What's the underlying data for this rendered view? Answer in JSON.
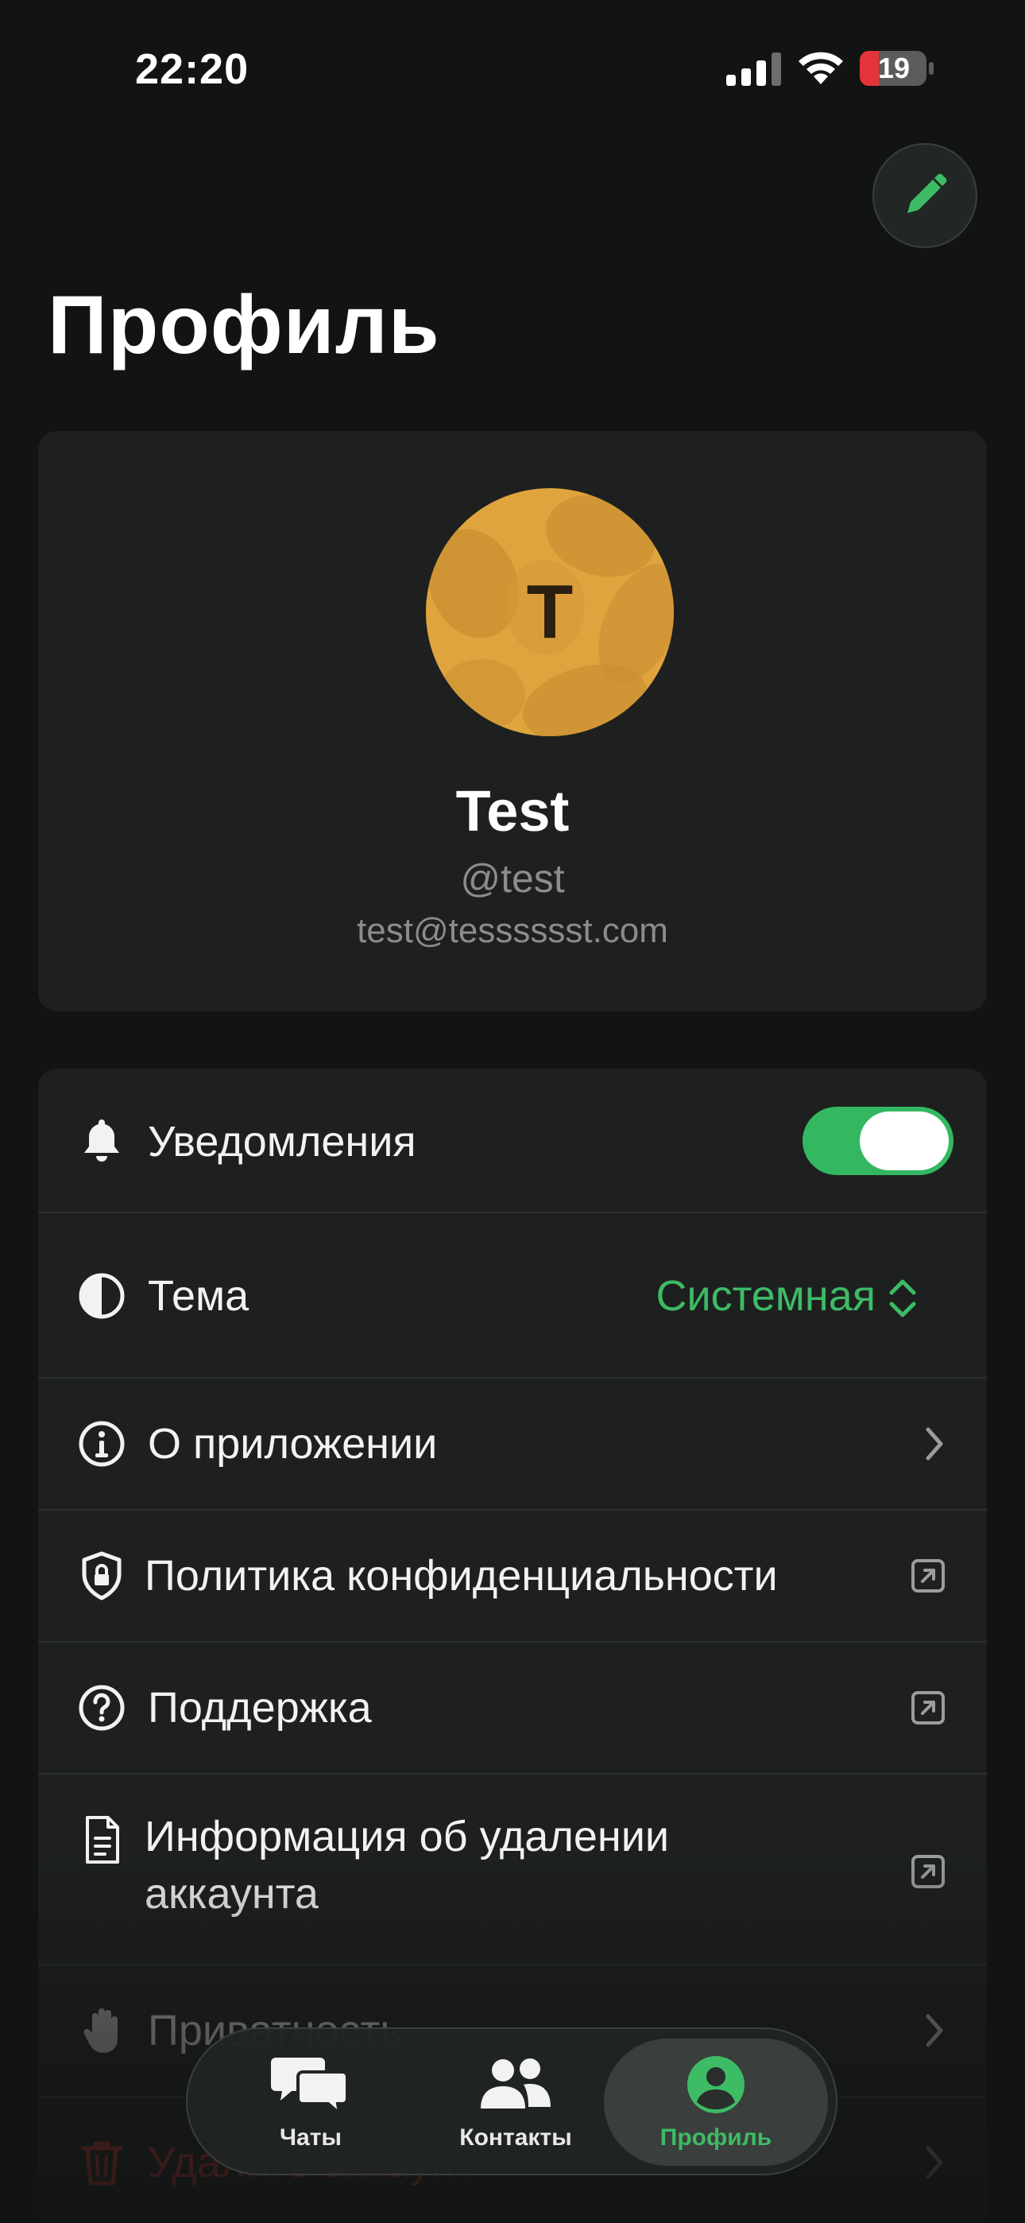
{
  "status_bar": {
    "time": "22:20",
    "battery": "19"
  },
  "header": {
    "title": "Профиль"
  },
  "profile": {
    "avatar_letter": "T",
    "name": "Test",
    "username": "@test",
    "email": "test@tesssssst.com"
  },
  "settings": {
    "notifications": {
      "label": "Уведомления",
      "enabled": true
    },
    "theme": {
      "label": "Тема",
      "value": "Системная"
    },
    "about": {
      "label": "О приложении"
    },
    "privacy_policy": {
      "label": "Политика конфиденциальности"
    },
    "support": {
      "label": "Поддержка"
    },
    "delete_info": {
      "label_line1": "Информация об удалении",
      "label_line2": "аккаунта"
    },
    "privacy": {
      "label": "Приватность"
    },
    "delete_account": {
      "label": "Удалить аккаунт"
    }
  },
  "tab_bar": {
    "tabs": [
      {
        "label": "Чаты",
        "icon": "chats-icon"
      },
      {
        "label": "Контакты",
        "icon": "contacts-icon"
      },
      {
        "label": "Профиль",
        "icon": "profile-icon",
        "active": true
      }
    ]
  },
  "colors": {
    "accent": "#3dbb65",
    "danger": "#b2312d",
    "background": "#121413",
    "card": "#1d201f",
    "avatar": "#e0a43f"
  }
}
